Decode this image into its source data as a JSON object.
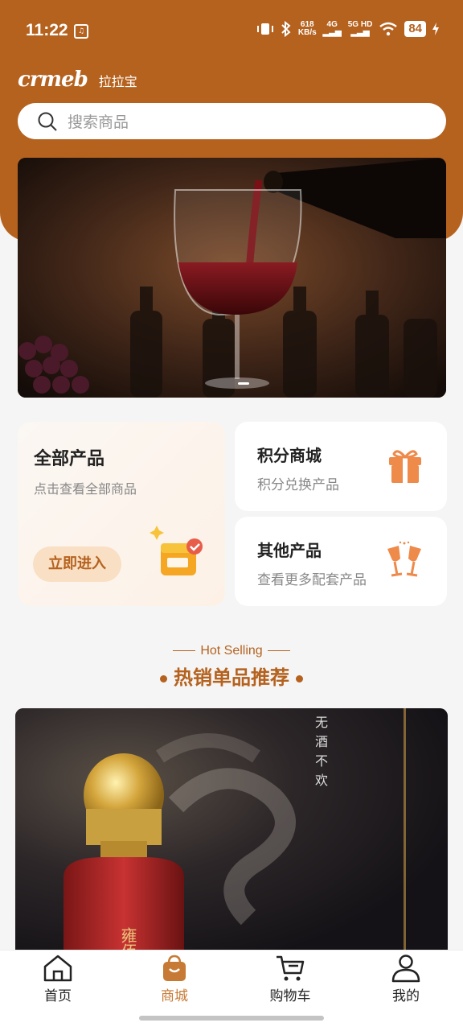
{
  "status": {
    "time": "11:22",
    "net_speed": "618",
    "net_unit": "KB/s",
    "sig1": "4G",
    "sig2": "5G HD",
    "battery": "84"
  },
  "brand": {
    "logo": "crmeb",
    "name": "拉拉宝"
  },
  "search": {
    "placeholder": "搜索商品"
  },
  "cards": {
    "all": {
      "title": "全部产品",
      "subtitle": "点击查看全部商品",
      "button": "立即进入"
    },
    "points": {
      "title": "积分商城",
      "subtitle": "积分兑换产品"
    },
    "other": {
      "title": "其他产品",
      "subtitle": "查看更多配套产品"
    }
  },
  "section": {
    "en": "Hot Selling",
    "cn": "热销单品推荐"
  },
  "promo": {
    "vertical_text": "无酒不欢",
    "bottle_text": "雍佰"
  },
  "tabbar": {
    "items": [
      {
        "label": "首页",
        "icon": "home-icon"
      },
      {
        "label": "商城",
        "icon": "shop-bag-icon",
        "active": true
      },
      {
        "label": "购物车",
        "icon": "cart-icon"
      },
      {
        "label": "我的",
        "icon": "user-icon"
      }
    ]
  },
  "colors": {
    "brand": "#b5621f",
    "accent": "#c77a35",
    "button_bg": "#f9dfc3"
  }
}
